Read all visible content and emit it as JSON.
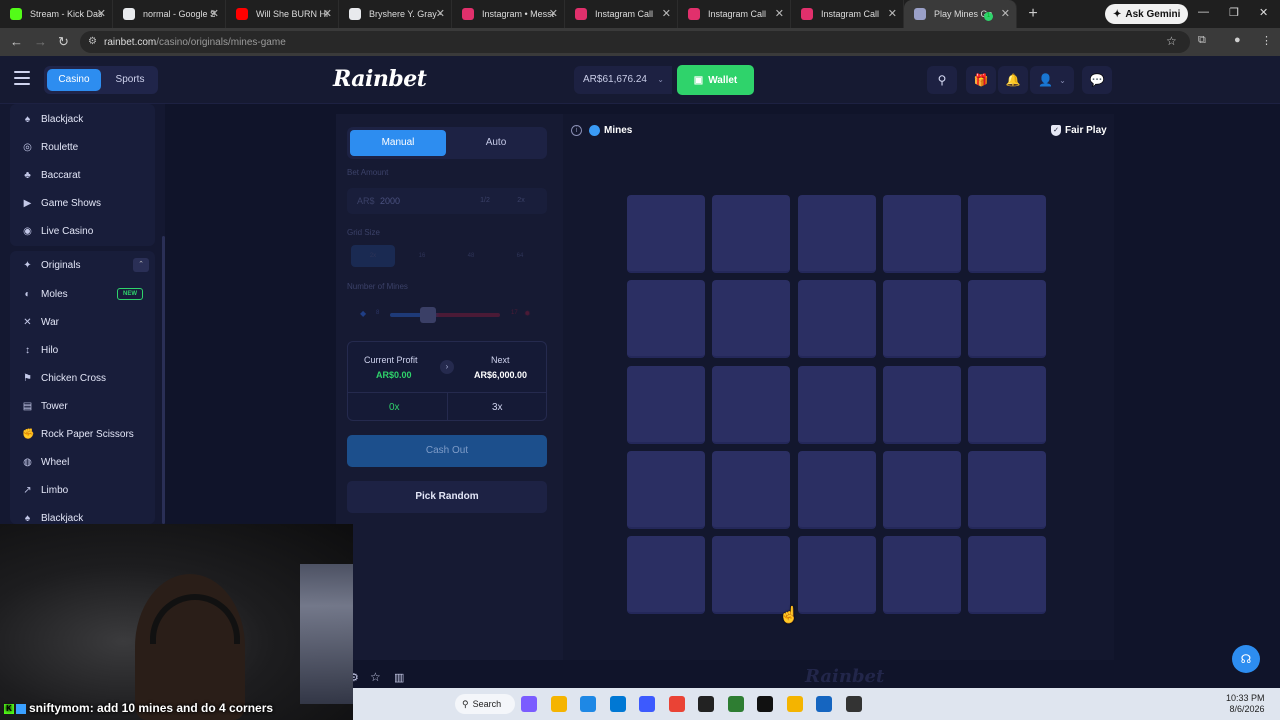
{
  "browser": {
    "tabs": [
      {
        "label": "Stream - Kick Dash",
        "color": "#53fc18"
      },
      {
        "label": "normal - Google S",
        "color": "#e8eaed"
      },
      {
        "label": "Will She BURN Hi",
        "color": "#ff0000"
      },
      {
        "label": "Bryshere Y. Gray -",
        "color": "#e8eaed"
      },
      {
        "label": "Instagram • Messa",
        "color": "#e1306c"
      },
      {
        "label": "Instagram Call",
        "color": "#e1306c"
      },
      {
        "label": "Instagram Call",
        "color": "#e1306c"
      },
      {
        "label": "Instagram Call",
        "color": "#e1306c"
      },
      {
        "label": "Play Mines Ga",
        "color": "#9aa0c8"
      }
    ],
    "ask_gemini": "Ask Gemini",
    "url_host": "rainbet.com",
    "url_path": "/casino/originals/mines-game"
  },
  "header": {
    "casino": "Casino",
    "sports": "Sports",
    "logo": "Rainbet",
    "balance": "AR$61,676.24",
    "wallet": "Wallet",
    "gift_count": "1"
  },
  "sidebar": {
    "items_top": [
      "Blackjack",
      "Roulette",
      "Baccarat",
      "Game Shows",
      "Live Casino"
    ],
    "originals_label": "Originals",
    "originals_items": [
      "Moles",
      "War",
      "Hilo",
      "Chicken Cross",
      "Tower",
      "Rock Paper Scissors",
      "Wheel",
      "Limbo",
      "Blackjack"
    ],
    "new_badge": "NEW"
  },
  "controls": {
    "tab_manual": "Manual",
    "tab_auto": "Auto",
    "bet_label": "Bet Amount",
    "bet_currency": "AR$",
    "bet_value": "2000",
    "bet_half": "1/2",
    "bet_double": "2x",
    "grid_label": "Grid Size",
    "grid_options": [
      "2x",
      "16",
      "48",
      "64"
    ],
    "mines_label": "Number of Mines",
    "mines_min": "8",
    "mines_max": "17",
    "current_profit_label": "Current Profit",
    "current_profit_value": "AR$0.00",
    "next_label": "Next",
    "next_value": "AR$6,000.00",
    "mult_current": "0x",
    "mult_next": "3x",
    "cashout": "Cash Out",
    "pick_random": "Pick Random"
  },
  "game": {
    "title": "Mines",
    "fair_play": "Fair Play",
    "watermark": "Rainbet",
    "tiles_rows": 5,
    "tiles_cols": 5
  },
  "stream": {
    "chat_user": "sniftymom",
    "chat_message": ": add 10 mines and do 4 corners"
  },
  "taskbar": {
    "search": "Search",
    "time": "10:33 PM",
    "date": "8/6/2026"
  }
}
